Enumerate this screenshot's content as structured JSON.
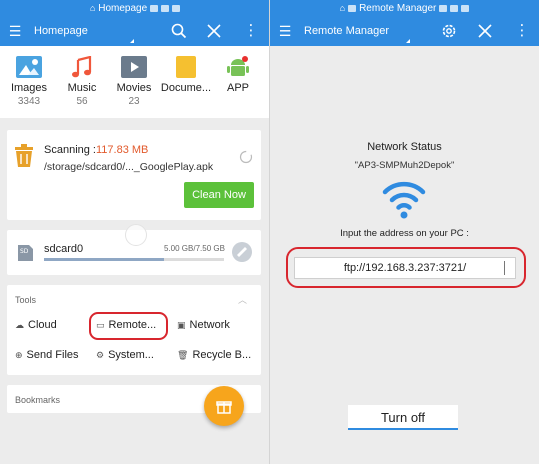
{
  "left": {
    "statusbar": {
      "title": "Homepage"
    },
    "toolbar": {
      "title": "Homepage"
    },
    "categories": [
      {
        "label": "Images",
        "count": "3343",
        "icon": "images-icon"
      },
      {
        "label": "Music",
        "count": "56",
        "icon": "music-icon"
      },
      {
        "label": "Movies",
        "count": "23",
        "icon": "movies-icon"
      },
      {
        "label": "Docume...",
        "count": "",
        "icon": "document-icon"
      },
      {
        "label": "APP",
        "count": "",
        "icon": "android-icon"
      }
    ],
    "scan": {
      "prefix": "Scanning :",
      "size": "117.83 MB",
      "path": "/storage/sdcard0/..._GooglePlay.apk",
      "button": "Clean Now"
    },
    "storage": {
      "name": "sdcard0",
      "size": "5.00 GB/7.50 GB",
      "used_fraction": 0.6667
    },
    "tools": {
      "title": "Tools",
      "items": [
        "Cloud",
        "Remote...",
        "Network",
        "Send Files",
        "System...",
        "Recycle B..."
      ]
    },
    "bookmarks": {
      "title": "Bookmarks"
    }
  },
  "right": {
    "statusbar": {
      "title": "Remote Manager"
    },
    "toolbar": {
      "title": "Remote Manager"
    },
    "network_status": "Network Status",
    "ssid": "\"AP3-SMPMuh2Depok\"",
    "address_label": "Input the address on your PC :",
    "address": "ftp://192.168.3.237:3721/",
    "turn_off": "Turn off"
  },
  "colors": {
    "accent": "#2f8be0",
    "clean": "#5cc13a",
    "fab": "#f7a51c",
    "highlight": "#d8262e",
    "scan_size": "#e25a2c"
  }
}
